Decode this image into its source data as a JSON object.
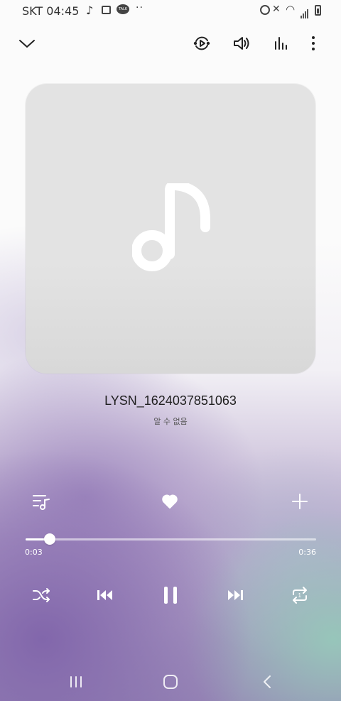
{
  "status_bar": {
    "carrier_time": "SKT 04:45",
    "talk_badge": "TALK",
    "more_dots": "··"
  },
  "toolbar": {
    "icons": [
      "chevron-down-icon",
      "smart-view-icon",
      "volume-icon",
      "equalizer-icon",
      "more-options-icon"
    ]
  },
  "track": {
    "title": "LYSN_1624037851063",
    "artist": "알 수 없음"
  },
  "actions": {
    "icons": [
      "playlist-icon",
      "favorite-heart-icon",
      "add-icon"
    ]
  },
  "playback": {
    "elapsed": "0:03",
    "duration": "0:36",
    "progress_fraction": 0.083
  },
  "controls": {
    "icons": [
      "shuffle-icon",
      "previous-icon",
      "pause-icon",
      "next-icon",
      "repeat-one-icon"
    ],
    "repeat_badge": "1"
  },
  "nav_bar": {
    "icons": [
      "recent-apps-icon",
      "home-icon",
      "back-icon"
    ]
  },
  "colors": {
    "accent_white": "#ffffff",
    "purple": "#8c78b4",
    "teal": "#96c8b9"
  }
}
